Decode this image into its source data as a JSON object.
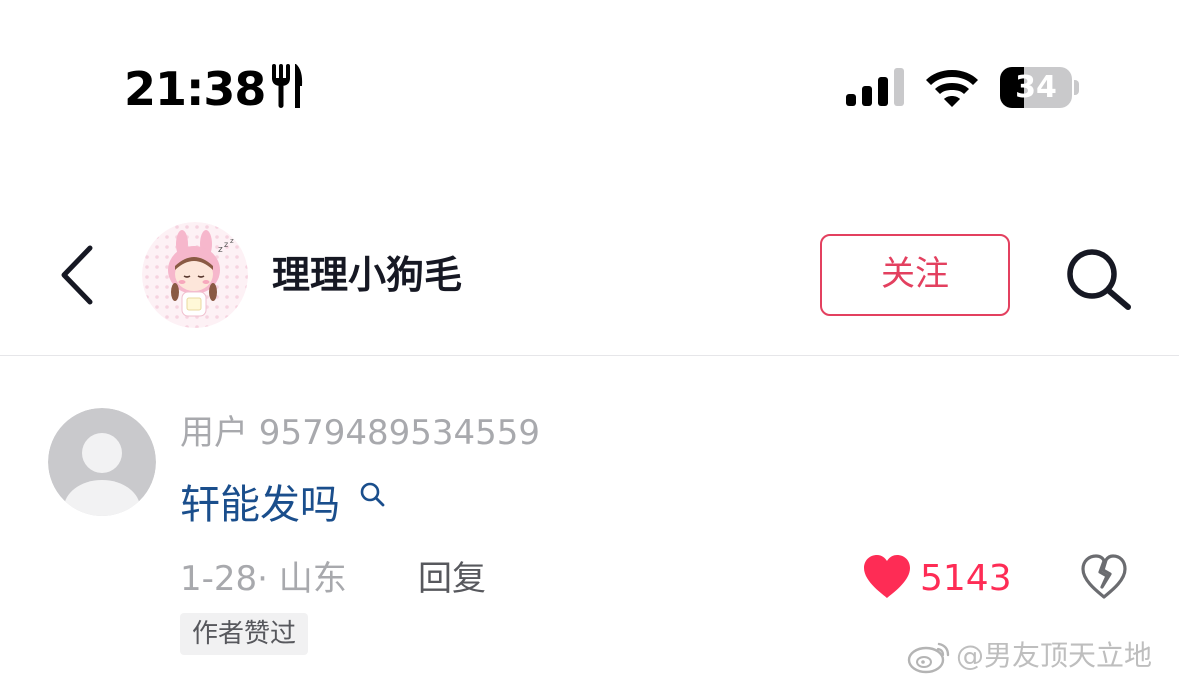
{
  "status_bar": {
    "time": "21:38",
    "activity_icon": "fork-knife-icon",
    "signal_icon": "cellular-signal-icon",
    "wifi_icon": "wifi-icon",
    "battery_level": "34",
    "battery_fraction": 0.34
  },
  "header": {
    "back_icon": "chevron-left-icon",
    "account_name": "理理小狗毛",
    "follow_label": "关注",
    "search_icon": "search-icon"
  },
  "comment": {
    "username": "用户 9579489534559",
    "text": "轩能发吗",
    "text_search_icon": "search-icon",
    "meta": "1-28· 山东",
    "reply_label": "回复",
    "like_count": "5143",
    "like_icon": "heart-filled-icon",
    "dislike_icon": "broken-heart-icon",
    "author_badge": "作者赞过"
  },
  "watermark": {
    "logo": "weibo-logo",
    "text": "@男友顶天立地"
  },
  "colors": {
    "accent": "#fe2c55",
    "follow_border": "#e3405f",
    "link_text": "#1a4e8c",
    "muted_text": "#a8a9ad"
  }
}
